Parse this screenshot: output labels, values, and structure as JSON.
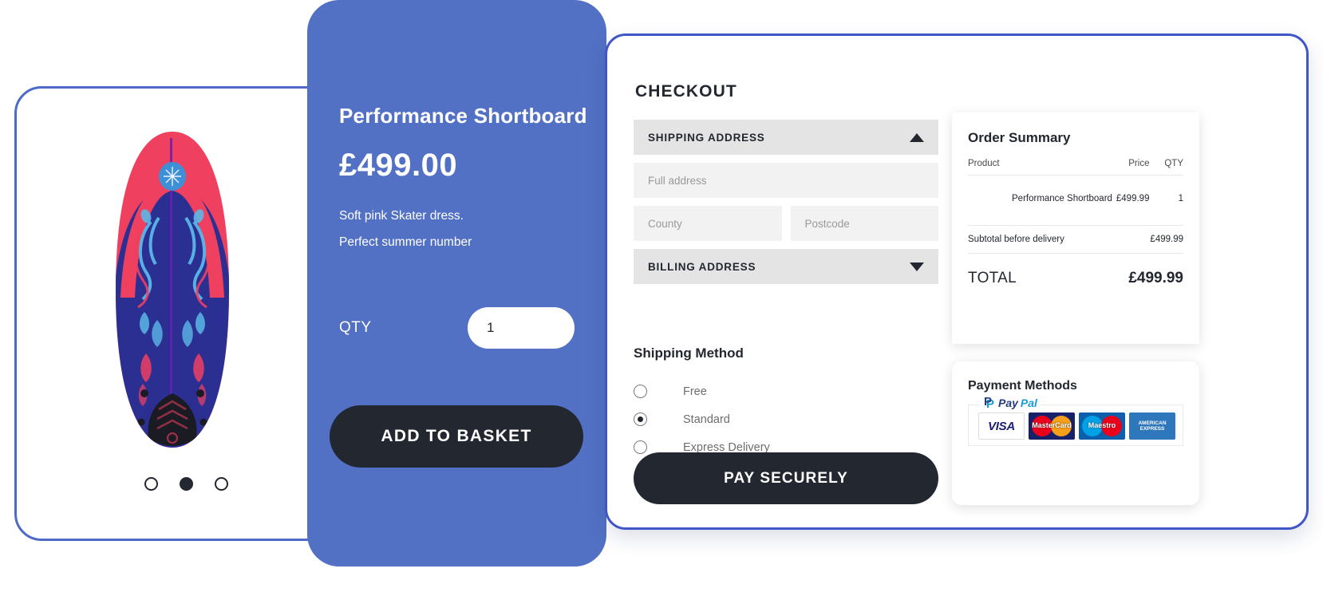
{
  "theme": {
    "blue_panel": "#5271c4",
    "border_blue": "#3f56c9",
    "dark": "#232730",
    "field_grey": "#f2f2f2",
    "accordion_grey": "#e4e4e4"
  },
  "product": {
    "title": "Performance Shortboard",
    "price": "£499.00",
    "description_line1": "Soft pink Skater dress.",
    "description_line2": "Perfect summer number",
    "qty_label": "QTY",
    "qty_value": "1",
    "add_to_basket_label": "ADD TO BASKET",
    "carousel": {
      "count": 3,
      "active_index": 1
    },
    "image_alt": "surfboard"
  },
  "checkout": {
    "title": "CHECKOUT",
    "shipping_address": {
      "label": "SHIPPING ADDRESS",
      "expanded": true,
      "caret": "caret-up-icon"
    },
    "billing_address": {
      "label": "BILLING ADDRESS",
      "expanded": false,
      "caret": "caret-down-icon"
    },
    "fields": {
      "full_address": {
        "placeholder": "Full address",
        "value": ""
      },
      "county": {
        "placeholder": "County",
        "value": ""
      },
      "postcode": {
        "placeholder": "Postcode",
        "value": ""
      }
    },
    "shipping_method": {
      "title": "Shipping Method",
      "options": [
        {
          "label": "Free",
          "selected": false
        },
        {
          "label": "Standard",
          "selected": true
        },
        {
          "label": "Express Delivery",
          "selected": false
        }
      ]
    },
    "pay_button_label": "PAY SECURELY"
  },
  "order_summary": {
    "title": "Order Summary",
    "columns": [
      "Product",
      "Price",
      "QTY"
    ],
    "items": [
      {
        "product": "Performance Shortboard",
        "price": "£499.99",
        "qty": "1"
      }
    ],
    "subtotal_label": "Subtotal before delivery",
    "subtotal_value": "£499.99",
    "total_label": "TOTAL",
    "total_value": "£499.99"
  },
  "payment_methods": {
    "title": "Payment Methods",
    "paypal": {
      "word1": "Pay",
      "word2": "Pal"
    },
    "cards": [
      {
        "name": "VISA",
        "type": "visa"
      },
      {
        "name": "MasterCard",
        "type": "mastercard"
      },
      {
        "name": "Maestro",
        "type": "maestro"
      },
      {
        "name": "AMERICAN EXPRESS",
        "type": "amex"
      }
    ]
  }
}
